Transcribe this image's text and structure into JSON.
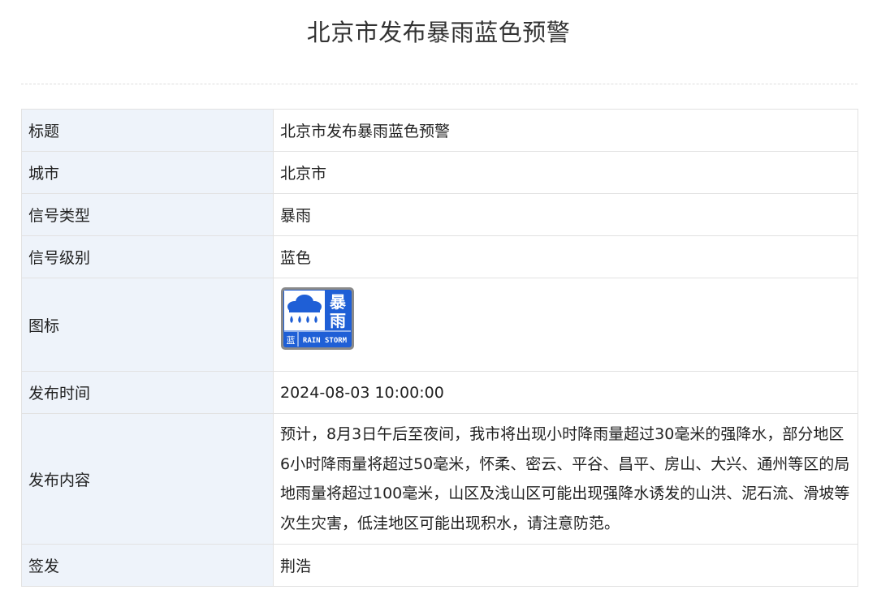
{
  "header": {
    "title": "北京市发布暴雨蓝色预警"
  },
  "rows": [
    {
      "label": "标题",
      "value": "北京市发布暴雨蓝色预警"
    },
    {
      "label": "城市",
      "value": "北京市"
    },
    {
      "label": "信号类型",
      "value": "暴雨"
    },
    {
      "label": "信号级别",
      "value": "蓝色"
    },
    {
      "label": "图标",
      "value": ""
    },
    {
      "label": "发布时间",
      "value": "2024-08-03 10:00:00"
    },
    {
      "label": "发布内容",
      "value": "预计，8月3日午后至夜间，我市将出现小时降雨量超过30毫米的强降水，部分地区6小时降雨量将超过50毫米，怀柔、密云、平谷、昌平、房山、大兴、通州等区的局地雨量将超过100毫米，山区及浅山区可能出现强降水诱发的山洪、泥石流、滑坡等次生灾害，低洼地区可能出现积水，请注意防范。"
    },
    {
      "label": "签发",
      "value": "荆浩"
    }
  ],
  "icon": {
    "name": "rainstorm-blue-warning-icon",
    "text_top": "暴",
    "text_bottom": "雨",
    "level_char": "蓝",
    "english": "RAIN STORM",
    "color_blue": "#1f5fd6",
    "color_frame": "#8a8a8a"
  }
}
